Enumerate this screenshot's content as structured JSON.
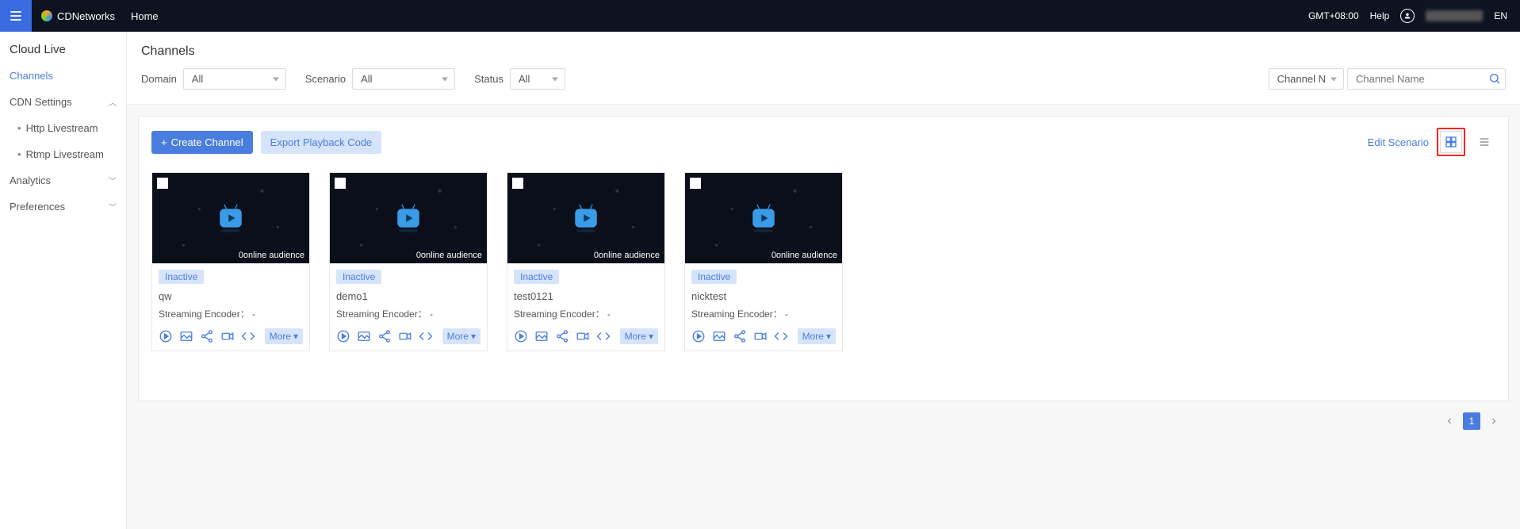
{
  "header": {
    "brand": "CDNetworks",
    "home": "Home",
    "timezone": "GMT+08:00",
    "help": "Help",
    "lang": "EN"
  },
  "sidebar": {
    "title": "Cloud Live",
    "items": [
      {
        "label": "Channels",
        "active": true
      },
      {
        "label": "CDN Settings",
        "expandable": true,
        "expanded": true,
        "children": [
          {
            "label": "Http Livestream"
          },
          {
            "label": "Rtmp Livestream"
          }
        ]
      },
      {
        "label": "Analytics",
        "expandable": true
      },
      {
        "label": "Preferences",
        "expandable": true
      }
    ]
  },
  "page": {
    "title": "Channels",
    "filters": {
      "domain_label": "Domain",
      "domain_value": "All",
      "scenario_label": "Scenario",
      "scenario_value": "All",
      "status_label": "Status",
      "status_value": "All",
      "search_type": "Channel N",
      "search_placeholder": "Channel Name"
    },
    "toolbar": {
      "create": "Create Channel",
      "export": "Export Playback Code",
      "edit_scenario": "Edit Scenario"
    },
    "cards": [
      {
        "status": "Inactive",
        "name": "qw",
        "encoder_label": "Streaming Encoder：",
        "encoder_value": "-",
        "audience": "0online audience",
        "more": "More"
      },
      {
        "status": "Inactive",
        "name": "demo1",
        "encoder_label": "Streaming Encoder：",
        "encoder_value": "-",
        "audience": "0online audience",
        "more": "More"
      },
      {
        "status": "Inactive",
        "name": "test0121",
        "encoder_label": "Streaming Encoder：",
        "encoder_value": "-",
        "audience": "0online audience",
        "more": "More"
      },
      {
        "status": "Inactive",
        "name": "nicktest",
        "encoder_label": "Streaming Encoder：",
        "encoder_value": "-",
        "audience": "0online audience",
        "more": "More"
      }
    ],
    "pagination": {
      "current": "1"
    }
  }
}
